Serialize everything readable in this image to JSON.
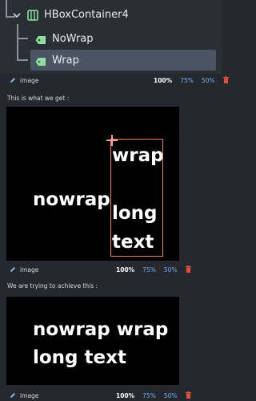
{
  "tree": {
    "container_label": "HBoxContainer4",
    "children": [
      {
        "label": "NoWrap",
        "selected": false
      },
      {
        "label": "Wrap",
        "selected": true
      }
    ]
  },
  "toolbars": [
    {
      "edit_label": "image",
      "zoom_options": [
        "100%",
        "75%",
        "50%"
      ],
      "active_zoom": "100%"
    },
    {
      "edit_label": "image",
      "zoom_options": [
        "100%",
        "75%",
        "50%"
      ],
      "active_zoom": "100%"
    },
    {
      "edit_label": "image",
      "zoom_options": [
        "100%",
        "75%",
        "50%"
      ],
      "active_zoom": "100%"
    }
  ],
  "captions": {
    "first": "This is what we get :",
    "second": "We are trying to achieve this :"
  },
  "panel1": {
    "nowrap_text": "nowrap",
    "wrap_line1": "wrap",
    "wrap_line2": "long",
    "wrap_line3": "text"
  },
  "panel2": {
    "line1": "nowrap wrap",
    "line2": "long text"
  },
  "colors": {
    "background": "#25292f",
    "node_icon_green": "#8fe0a0",
    "selection_outline": "#f2804f",
    "zoom_link": "#6fb1ea",
    "trash_red": "#e0513c"
  }
}
